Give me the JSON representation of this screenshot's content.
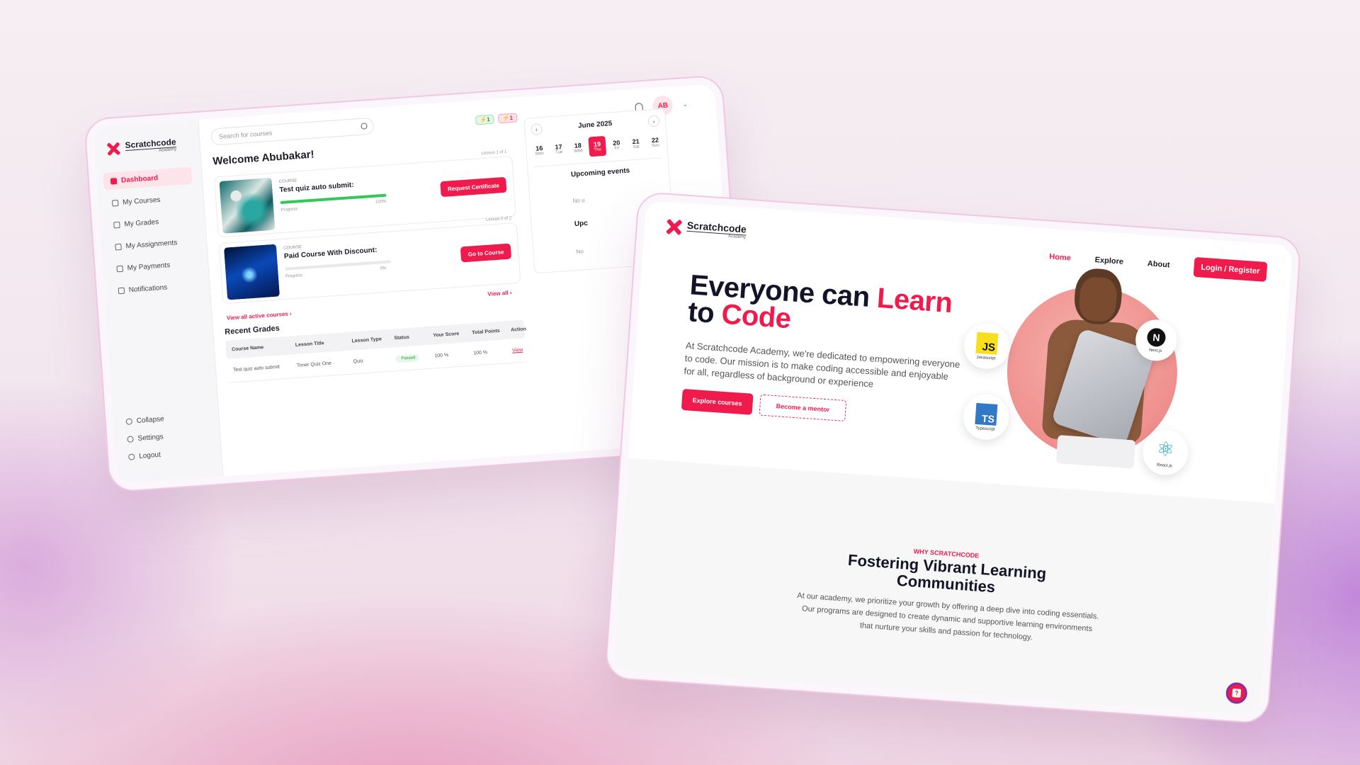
{
  "dashboard": {
    "logo": {
      "name": "Scratchcode",
      "sub": "Academy"
    },
    "nav": [
      {
        "label": "Dashboard",
        "icon": "grid-icon",
        "active": true
      },
      {
        "label": "My Courses",
        "icon": "book-icon"
      },
      {
        "label": "My Grades",
        "icon": "file-icon"
      },
      {
        "label": "My Assignments",
        "icon": "file-icon"
      },
      {
        "label": "My Payments",
        "icon": "wallet-icon"
      },
      {
        "label": "Notifications",
        "icon": "bell-icon"
      }
    ],
    "bottom": [
      {
        "label": "Collapse",
        "icon": "collapse-icon"
      },
      {
        "label": "Settings",
        "icon": "gear-icon"
      },
      {
        "label": "Logout",
        "icon": "logout-icon"
      }
    ],
    "search_placeholder": "Search for courses",
    "badges": [
      "1",
      "1"
    ],
    "avatar": "AB",
    "welcome": "Welcome Abubakar!",
    "courses": [
      {
        "label": "COURSE",
        "title": "Test quiz auto submit:",
        "progress_label": "Progress",
        "progress": "100%",
        "lesson": "Lesson 1 of 1",
        "button": "Request Certificate"
      },
      {
        "label": "COURSE",
        "title": "Paid Course With Discount:",
        "progress_label": "Progress",
        "progress": "0%",
        "lesson": "Lesson 0 of 2",
        "button": "Go to Course"
      }
    ],
    "view_active": "View all active courses",
    "view_all": "View all",
    "recent_grades": "Recent Grades",
    "grade_headers": [
      "Course Name",
      "Lesson Title",
      "Lesson Type",
      "Status",
      "Your Score",
      "Total Points",
      "Action"
    ],
    "grade_rows": [
      [
        "Test quiz auto submit",
        "Timer Quiz One",
        "Quiz",
        "Passed",
        "100 %",
        "100 %",
        "View"
      ]
    ],
    "calendar": {
      "month": "June 2025",
      "days": [
        {
          "num": "16",
          "name": "Mon"
        },
        {
          "num": "17",
          "name": "Tue"
        },
        {
          "num": "18",
          "name": "Wed"
        },
        {
          "num": "19",
          "name": "Thu"
        },
        {
          "num": "20",
          "name": "Fri"
        },
        {
          "num": "21",
          "name": "Sat"
        },
        {
          "num": "22",
          "name": "Sun"
        }
      ],
      "selected": "19",
      "upcoming": "Upcoming events",
      "no_1": "No u",
      "up_2": "Upc",
      "no_2": "No"
    }
  },
  "landing": {
    "logo": {
      "name": "Scratchcode",
      "sub": "Academy"
    },
    "nav": [
      "Home",
      "Explore",
      "About"
    ],
    "login": "Login / Register",
    "hero_line1_a": "Everyone can ",
    "hero_line1_b": "Learn",
    "hero_line2_a": "to ",
    "hero_line2_b": "Code",
    "hero_sub": "At Scratchcode Academy, we're dedicated to empowering everyone to code. Our mission is to make coding accessible and enjoyable for all, regardless of background or experience",
    "btn_explore": "Explore courses",
    "btn_mentor": "Become a mentor",
    "tech": [
      {
        "label": "Javascript",
        "badge": "JS"
      },
      {
        "label": "Typescript",
        "badge": "TS"
      },
      {
        "label": "Next.js",
        "badge": "N"
      },
      {
        "label": "React.js",
        "badge": "⚛"
      }
    ],
    "why_tag": "WHY SCRATCHCODE",
    "why_title": "Fostering Vibrant Learning Communities",
    "why_body": "At our academy, we prioritize your growth by offering a deep dive into coding essentials. Our programs are designed to create dynamic and supportive learning environments that nurture your skills and passion for technology.",
    "help": "?"
  },
  "colors": {
    "accent": "#ef1b4d",
    "success": "#34c759"
  }
}
